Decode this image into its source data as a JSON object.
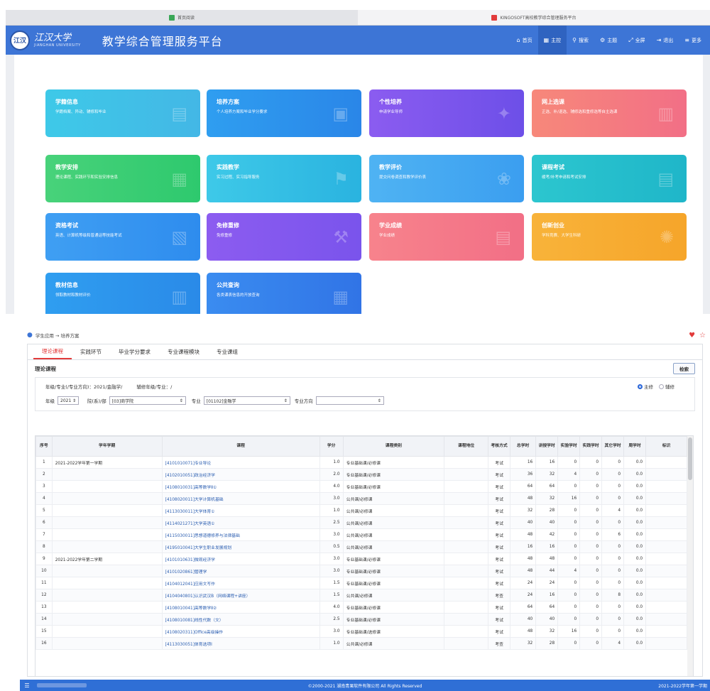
{
  "browser": {
    "tabs": [
      {
        "title": "首页阅读",
        "active": false,
        "fav_color": "#3aa757"
      },
      {
        "title": "KINGOSOFT高校教学综合管理服务平台",
        "active": true,
        "fav_color": "#e23b3b"
      }
    ]
  },
  "header": {
    "logo_cn": "江汉大学",
    "logo_en": "JIANGHAN UNIVERSITY",
    "seal_text": "江汉",
    "title": "教学综合管理服务平台",
    "nav": [
      {
        "icon": "home-icon",
        "glyph": "⌂",
        "label": "首页",
        "active": false
      },
      {
        "icon": "dashboard-icon",
        "glyph": "▦",
        "label": "主控",
        "active": true
      },
      {
        "icon": "search-icon",
        "glyph": "⚲",
        "label": "搜索",
        "active": false
      },
      {
        "icon": "theme-icon",
        "glyph": "⚙",
        "label": "主题",
        "active": false
      },
      {
        "icon": "fullscreen-icon",
        "glyph": "⤢",
        "label": "全屏",
        "active": false
      },
      {
        "icon": "logout-icon",
        "glyph": "⇥",
        "label": "退出",
        "active": false
      },
      {
        "icon": "more-icon",
        "glyph": "≡",
        "label": "更多",
        "active": false
      }
    ]
  },
  "tiles": [
    {
      "name": "tile-xueji",
      "title": "学籍信息",
      "desc": "学籍档案、异动、辅修和毕业",
      "icon": "id-card-icon",
      "glyph": "▤",
      "row": 1,
      "col": 1,
      "bg": "linear-gradient(90deg,#3ec9e8,#43b7e6)"
    },
    {
      "name": "tile-peiyang",
      "title": "培养方案",
      "desc": "个人培养方案和毕业学分要求",
      "icon": "clipboard-icon",
      "glyph": "▣",
      "row": 1,
      "col": 2,
      "bg": "linear-gradient(90deg,#2f9ef0,#2a86e8)"
    },
    {
      "name": "tile-gexing",
      "title": "个性培养",
      "desc": "申请学业导师",
      "icon": "wand-icon",
      "glyph": "✦",
      "row": 1,
      "col": 3,
      "bg": "linear-gradient(90deg,#8b5cf0,#6d4fe8)"
    },
    {
      "name": "tile-xuanke",
      "title": "网上选课",
      "desc": "正选、补/退选、辅修选和重修选等自主选课",
      "icon": "calendar-icon",
      "glyph": "▥",
      "row": 1,
      "col": 4,
      "bg": "linear-gradient(90deg,#f7887a,#f26f86)"
    },
    {
      "name": "tile-anpai",
      "title": "教学安排",
      "desc": "理论课程、实践环节和实验安排信息",
      "icon": "timetable-icon",
      "glyph": "▦",
      "row": 2,
      "col": 1,
      "bg": "linear-gradient(90deg,#48d27a,#2ec96e)"
    },
    {
      "name": "tile-shijian",
      "title": "实践教学",
      "desc": "实习过程、实习指导服务",
      "icon": "flag-icon",
      "glyph": "⚑",
      "row": 2,
      "col": 2,
      "bg": "linear-gradient(90deg,#3ec9e8,#2ab3e0)"
    },
    {
      "name": "tile-pingjia",
      "title": "教学评价",
      "desc": "提交问卷调查和教学评价表",
      "icon": "lotus-icon",
      "glyph": "❀",
      "row": 2,
      "col": 3,
      "bg": "linear-gradient(90deg,#4fb3f3,#3b9ef0)"
    },
    {
      "name": "tile-kaoshi",
      "title": "课程考试",
      "desc": "缓考/补考申请和考试安排",
      "icon": "document-icon",
      "glyph": "▤",
      "row": 2,
      "col": 4,
      "bg": "linear-gradient(90deg,#2cc6cf,#1fb6c9)"
    },
    {
      "name": "tile-zige",
      "title": "资格考试",
      "desc": "英语、计算机等级和普通话等技能考试",
      "icon": "certificate-icon",
      "glyph": "▧",
      "row": 3,
      "col": 1,
      "bg": "linear-gradient(90deg,#3f9ff3,#2e8cee)"
    },
    {
      "name": "tile-mianxiu",
      "title": "免修重修",
      "desc": "免修重修",
      "icon": "tools-icon",
      "glyph": "⚒",
      "row": 3,
      "col": 2,
      "bg": "linear-gradient(90deg,#8c5cf0,#7a54ec)"
    },
    {
      "name": "tile-chengji",
      "title": "学业成绩",
      "desc": "学业成绩",
      "icon": "report-icon",
      "glyph": "▤",
      "row": 3,
      "col": 3,
      "bg": "linear-gradient(90deg,#f7838c,#f26f86)"
    },
    {
      "name": "tile-chuangxin",
      "title": "创新创业",
      "desc": "学科竞赛、大学生科研",
      "icon": "lightbulb-icon",
      "glyph": "✺",
      "row": 3,
      "col": 4,
      "bg": "linear-gradient(90deg,#f8b33a,#f6a52a)"
    },
    {
      "name": "tile-jiaocai",
      "title": "教材信息",
      "desc": "领取教材和教材评价",
      "icon": "books-icon",
      "glyph": "▥",
      "row": 4,
      "col": 1,
      "bg": "linear-gradient(90deg,#2f9ef0,#2a8ae8)"
    },
    {
      "name": "tile-chaxun",
      "title": "公共查询",
      "desc": "各类课表信息的开放查询",
      "icon": "calendar-icon",
      "glyph": "▦",
      "row": 4,
      "col": 2,
      "bg": "linear-gradient(90deg,#3a8cf0,#3174e6)"
    }
  ],
  "breadcrumb": "学生应用 → 培养方案",
  "tabs": [
    {
      "label": "理论课程",
      "active": true
    },
    {
      "label": "实践环节",
      "active": false
    },
    {
      "label": "毕业学分要求",
      "active": false
    },
    {
      "label": "专业课程模块",
      "active": false
    },
    {
      "label": "专业课组",
      "active": false
    }
  ],
  "section_title": "理论课程",
  "search_btn": "检索",
  "filter": {
    "grade_major": "年级/专业(/专业方向)：2021/金融学/",
    "minor": "辅修年级/专业：/",
    "radio_main": "主修",
    "radio_minor": "辅修",
    "grade_label": "年级",
    "grade_value": "2021",
    "dept_label": "院(系)/部",
    "dept_value": "[03]商学院",
    "major_label": "专业",
    "major_value": "[01102]金融学",
    "direction_label": "专业方向",
    "direction_value": ""
  },
  "table": {
    "headers": [
      "序号",
      "学年学期",
      "课程",
      "学分",
      "课程类别",
      "课程地位",
      "考核方式",
      "总学时",
      "讲授学时",
      "实验学时",
      "实践学时",
      "其它学时",
      "周学时",
      "标识"
    ],
    "rows": [
      [
        "1",
        "2021-2022学年第一学期",
        "[4101010071]专业导论",
        "1.0",
        "专业基础课/必修课",
        "",
        "考试",
        "16",
        "16",
        "0",
        "0",
        "0",
        "0.0",
        ""
      ],
      [
        "2",
        "",
        "[4102010051]政治经济学",
        "2.0",
        "专业基础课/必修课",
        "",
        "考试",
        "36",
        "32",
        "4",
        "0",
        "0",
        "0.0",
        ""
      ],
      [
        "3",
        "",
        "[4108010031]高等数学Ⅱ①",
        "4.0",
        "专业基础课/必修课",
        "",
        "考试",
        "64",
        "64",
        "0",
        "0",
        "0",
        "0.0",
        ""
      ],
      [
        "4",
        "",
        "[4108020011]大学计算机基础",
        "3.0",
        "公共课/必修课",
        "",
        "考试",
        "48",
        "32",
        "16",
        "0",
        "0",
        "0.0",
        ""
      ],
      [
        "5",
        "",
        "[4113030011]大学体育①",
        "1.0",
        "公共课/必修课",
        "",
        "考试",
        "32",
        "28",
        "0",
        "0",
        "4",
        "0.0",
        ""
      ],
      [
        "6",
        "",
        "[4114021271]大学英语①",
        "2.5",
        "公共课/必修课",
        "",
        "考试",
        "40",
        "40",
        "0",
        "0",
        "0",
        "0.0",
        ""
      ],
      [
        "7",
        "",
        "[4115030011]思想道德修养与法律基础",
        "3.0",
        "公共课/必修课",
        "",
        "考试",
        "48",
        "42",
        "0",
        "0",
        "6",
        "0.0",
        ""
      ],
      [
        "8",
        "",
        "[4195010041]大学生职业发展规划",
        "0.5",
        "公共课/必修课",
        "",
        "考试",
        "16",
        "16",
        "0",
        "0",
        "0",
        "0.0",
        ""
      ],
      [
        "9",
        "2021-2022学年第二学期",
        "[4101010631]微观经济学",
        "3.0",
        "专业基础课/必修课",
        "",
        "考试",
        "48",
        "48",
        "0",
        "0",
        "0",
        "0.0",
        ""
      ],
      [
        "10",
        "",
        "[4101020861]管理学",
        "3.0",
        "专业基础课/必修课",
        "",
        "考试",
        "48",
        "44",
        "4",
        "0",
        "0",
        "0.0",
        ""
      ],
      [
        "11",
        "",
        "[4104012041]应用文写作",
        "1.5",
        "专业基础课/必修课",
        "",
        "考试",
        "24",
        "24",
        "0",
        "0",
        "0",
        "0.0",
        ""
      ],
      [
        "12",
        "",
        "[4104040801]认识武汉B（网络课程+讲座）",
        "1.5",
        "公共课/必修课",
        "",
        "考查",
        "24",
        "16",
        "0",
        "0",
        "8",
        "0.0",
        ""
      ],
      [
        "13",
        "",
        "[4108010041]高等数学Ⅱ②",
        "4.0",
        "专业基础课/必修课",
        "",
        "考试",
        "64",
        "64",
        "0",
        "0",
        "0",
        "0.0",
        ""
      ],
      [
        "14",
        "",
        "[4108010081]线性代数（文）",
        "2.5",
        "专业基础课/必修课",
        "",
        "考试",
        "40",
        "40",
        "0",
        "0",
        "0",
        "0.0",
        ""
      ],
      [
        "15",
        "",
        "[4108020311]Office高级操作",
        "3.0",
        "专业基础课/选修课",
        "",
        "考试",
        "48",
        "32",
        "16",
        "0",
        "0",
        "0.0",
        ""
      ],
      [
        "16",
        "",
        "[4113030051]体育选项Ⅰ",
        "1.0",
        "公共课/必修课",
        "",
        "考查",
        "32",
        "28",
        "0",
        "0",
        "4",
        "0.0",
        ""
      ]
    ]
  },
  "footer": {
    "copyright": "©2000-2021 湖南青果软件有限公司 All Rights Reserved",
    "term": "2021-2022学年第一学期"
  }
}
